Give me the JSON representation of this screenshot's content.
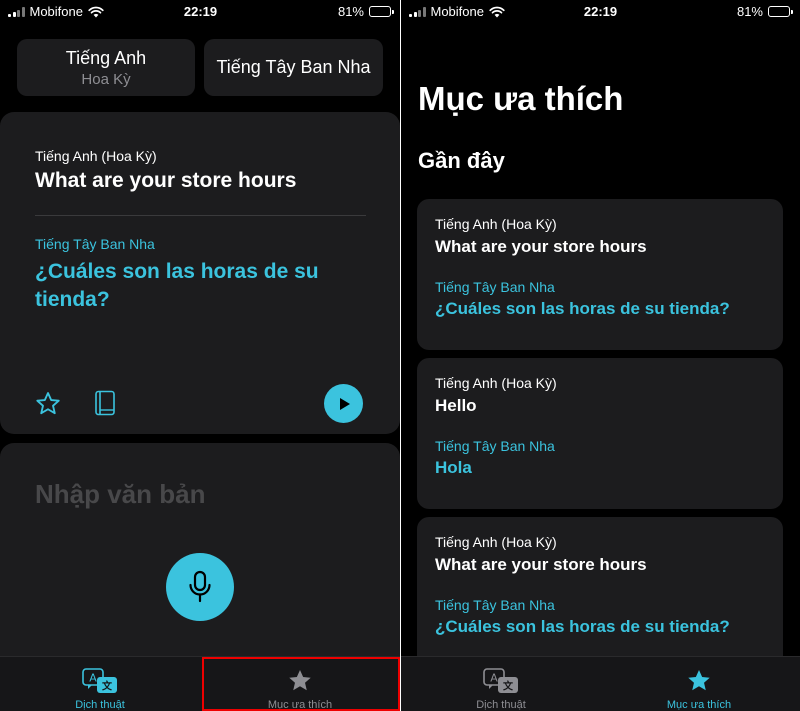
{
  "status_bar": {
    "carrier": "Mobifone",
    "time": "22:19",
    "battery": "81%"
  },
  "colors": {
    "accent": "#3bc3de",
    "card": "#1c1c1e",
    "highlight": "#ee0000"
  },
  "left": {
    "source_language": {
      "name": "Tiếng Anh",
      "region": "Hoa Kỳ"
    },
    "target_language": {
      "name": "Tiếng Tây Ban Nha"
    },
    "translation": {
      "source_label": "Tiếng Anh (Hoa Kỳ)",
      "source_text": "What are your store hours",
      "target_label": "Tiếng Tây Ban Nha",
      "target_text": "¿Cuáles son las horas de su tienda?"
    },
    "input_placeholder": "Nhập văn bản"
  },
  "tabs": {
    "translate": "Dịch thuật",
    "favorites": "Mục ưa thích"
  },
  "right": {
    "title": "Mục ưa thích",
    "section": "Gần đây",
    "cards": [
      {
        "src_lang": "Tiếng Anh (Hoa Kỳ)",
        "src_text": "What are your store hours",
        "dst_lang": "Tiếng Tây Ban Nha",
        "dst_text": "¿Cuáles son las horas de su tienda?"
      },
      {
        "src_lang": "Tiếng Anh (Hoa Kỳ)",
        "src_text": "Hello",
        "dst_lang": "Tiếng Tây Ban Nha",
        "dst_text": "Hola"
      },
      {
        "src_lang": "Tiếng Anh (Hoa Kỳ)",
        "src_text": "What are your store hours",
        "dst_lang": "Tiếng Tây Ban Nha",
        "dst_text": "¿Cuáles son las horas de su tienda?"
      }
    ]
  }
}
